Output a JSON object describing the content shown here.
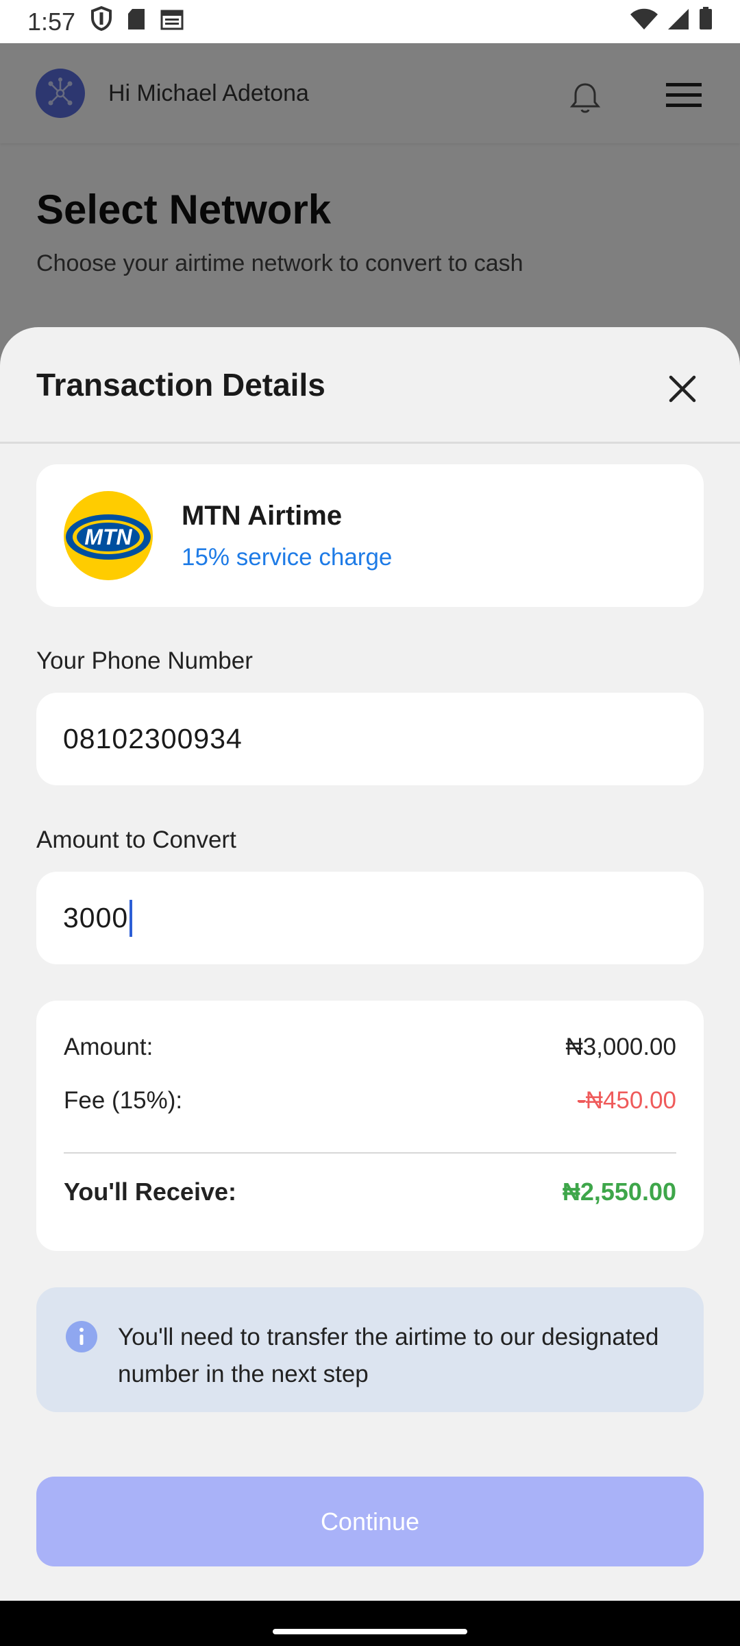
{
  "status_bar": {
    "time": "1:57",
    "icons_left": [
      "shield-icon",
      "sd-card-icon",
      "calendar-icon"
    ],
    "icons_right": [
      "wifi-icon",
      "signal-icon",
      "battery-icon"
    ]
  },
  "header": {
    "greeting": "Hi Michael Adetona",
    "icons": [
      "avatar-logo-icon",
      "bell-icon",
      "menu-icon"
    ]
  },
  "page": {
    "title": "Select Network",
    "subtitle": "Choose your airtime network to convert to cash"
  },
  "sheet": {
    "title": "Transaction Details",
    "network": {
      "logo_text": "MTN",
      "name": "MTN Airtime",
      "charge": "15% service charge"
    },
    "phone": {
      "label": "Your Phone Number",
      "value": "08102300934"
    },
    "amount": {
      "label": "Amount to Convert",
      "value": "3000"
    },
    "summary": {
      "amount_label": "Amount:",
      "amount_value": "₦3,000.00",
      "fee_label": "Fee (15%):",
      "fee_sign": "-",
      "fee_value": "₦450.00",
      "receive_label": "You'll Receive:",
      "receive_value": "₦2,550.00"
    },
    "info": {
      "text": "You'll need to transfer the airtime to our designated number in the next step"
    },
    "continue_label": "Continue"
  },
  "colors": {
    "accent_button": "#a9b2f8",
    "link_blue": "#1e7be6",
    "fee_red": "#ef5a5a",
    "receive_green": "#3ea64a",
    "mtn_yellow": "#ffcc00"
  }
}
